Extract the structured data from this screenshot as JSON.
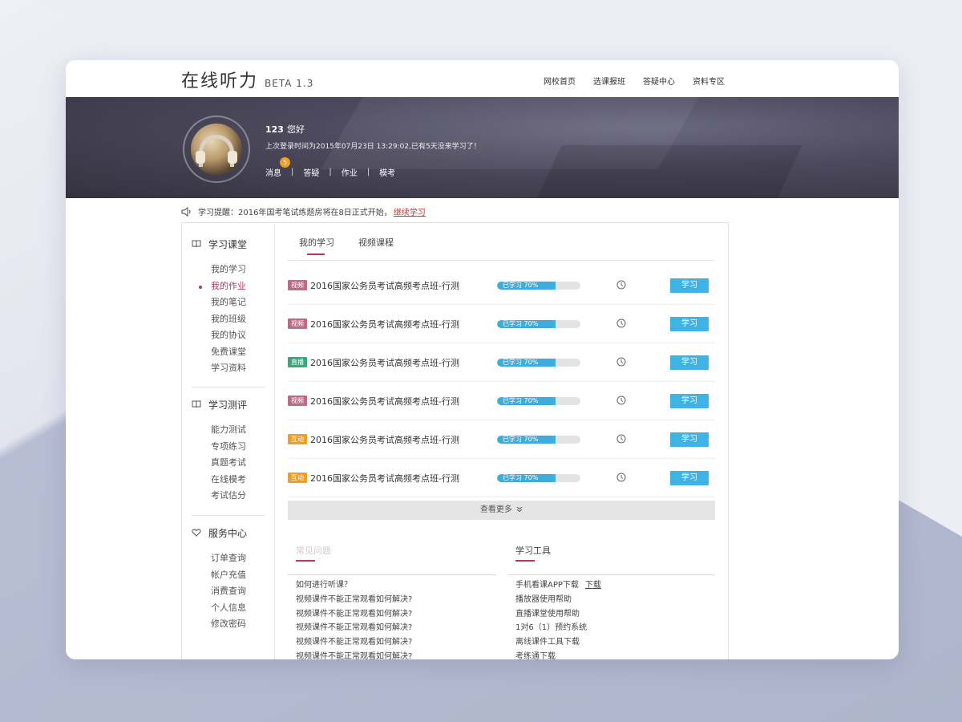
{
  "header": {
    "title": "在线听力",
    "version": "BETA 1.3",
    "nav": [
      "网校首页",
      "选课报班",
      "答疑中心",
      "资料专区"
    ]
  },
  "user": {
    "name": "123",
    "greeting": "您好",
    "last_login": "上次登录时间为2015年07月23日 13:29:02,已有5天没来学习了！",
    "nav": {
      "messages": "消息",
      "message_count": "5",
      "qa": "答疑",
      "homework": "作业",
      "mock": "模考",
      "separator": "|"
    }
  },
  "notice": {
    "text": "学习提醒：2016年国考笔试练题房将在8日正式开始，",
    "link": "继续学习"
  },
  "sidebar": {
    "sections": [
      {
        "title": "学习课堂",
        "icon": "book-icon",
        "items": [
          "我的学习",
          "我的作业",
          "我的笔记",
          "我的班级",
          "我的协议",
          "免费课堂",
          "学习资料"
        ]
      },
      {
        "title": "学习测评",
        "icon": "book-icon",
        "items": [
          "能力测试",
          "专项练习",
          "真题考试",
          "在线模考",
          "考试估分"
        ]
      },
      {
        "title": "服务中心",
        "icon": "heart-icon",
        "items": [
          "订单查询",
          "帐户充值",
          "消费查询",
          "个人信息",
          "修改密码"
        ]
      }
    ]
  },
  "tabs": [
    "我的学习",
    "视频课程"
  ],
  "courses": [
    {
      "tag": "视频",
      "tag_color": "#c06a8a",
      "title": "2016国家公务员考试高频考点班-行测",
      "progress_label": "已学习 70%",
      "progress": 70,
      "button": "学习"
    },
    {
      "tag": "视频",
      "tag_color": "#c06a8a",
      "title": "2016国家公务员考试高频考点班-行测",
      "progress_label": "已学习 70%",
      "progress": 70,
      "button": "学习"
    },
    {
      "tag": "直播",
      "tag_color": "#3aa67a",
      "title": "2016国家公务员考试高频考点班-行测",
      "progress_label": "已学习 70%",
      "progress": 70,
      "button": "学习"
    },
    {
      "tag": "视频",
      "tag_color": "#c06a8a",
      "title": "2016国家公务员考试高频考点班-行测",
      "progress_label": "已学习 70%",
      "progress": 70,
      "button": "学习"
    },
    {
      "tag": "互动",
      "tag_color": "#f0a020",
      "title": "2016国家公务员考试高频考点班-行测",
      "progress_label": "已学习 70%",
      "progress": 70,
      "button": "学习"
    },
    {
      "tag": "互动",
      "tag_color": "#f0a020",
      "title": "2016国家公务员考试高频考点班-行测",
      "progress_label": "已学习 70%",
      "progress": 70,
      "button": "学习"
    }
  ],
  "more": "查看更多",
  "faq": {
    "title": "常见问题",
    "items": [
      "如何进行听课？",
      "视频课件不能正常观看如何解决?",
      "视频课件不能正常观看如何解决?",
      "视频课件不能正常观看如何解决?",
      "视频课件不能正常观看如何解决?",
      "视频课件不能正常观看如何解决?"
    ]
  },
  "tools": {
    "title": "学习工具",
    "items": [
      "手机看课APP下载",
      "播放器使用帮助",
      "直播课堂使用帮助",
      "1对6（1）预约系统",
      "离线课件工具下载",
      "考练通下载"
    ],
    "download_link": "下载"
  },
  "colors": {
    "accent": "#b03a5b",
    "button": "#3fb2e6",
    "progress": "#3dadde",
    "notice_link": "#d0312d"
  }
}
